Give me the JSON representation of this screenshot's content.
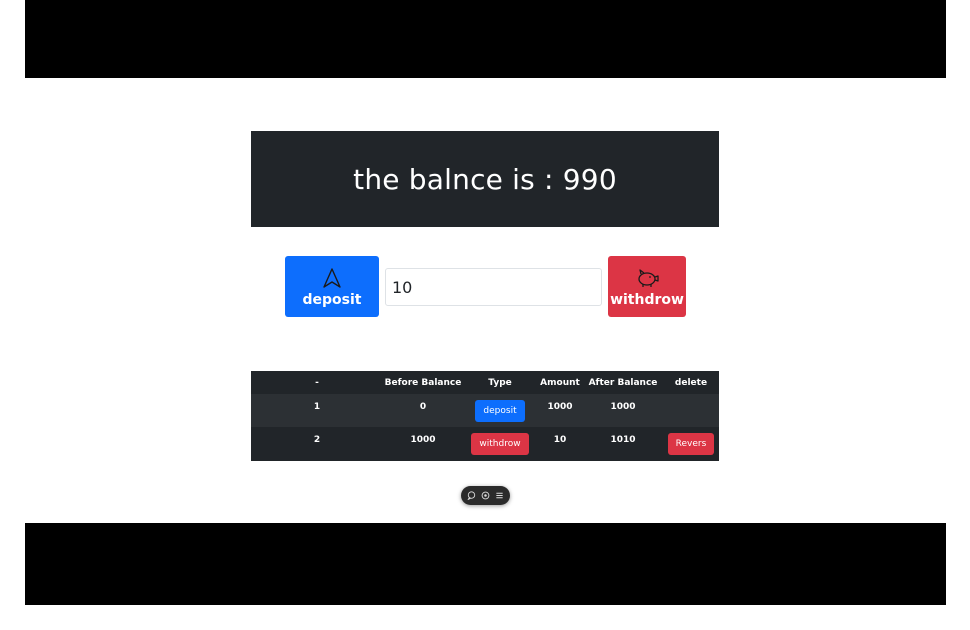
{
  "balance": {
    "text": "the balnce is : 990"
  },
  "controls": {
    "deposit_label": "deposit",
    "withdraw_label": "withdrow",
    "amount_value": "10",
    "deposit_color": "#0d6efd",
    "withdraw_color": "#dc3545",
    "deposit_icon": "navigation-arrow-icon",
    "withdraw_icon": "piggy-bank-icon"
  },
  "table": {
    "headers": [
      "-",
      "Before Balance",
      "Type",
      "Amount",
      "After Balance",
      "delete"
    ],
    "rows": [
      {
        "idx": "1",
        "before": "0",
        "type": "deposit",
        "amount": "1000",
        "after": "1000",
        "delete": ""
      },
      {
        "idx": "2",
        "before": "1000",
        "type": "withdrow",
        "amount": "10",
        "after": "1010",
        "delete": "Revers"
      }
    ]
  },
  "toolbar": {
    "icons": [
      "chat-icon",
      "eye-icon",
      "menu-icon"
    ]
  }
}
